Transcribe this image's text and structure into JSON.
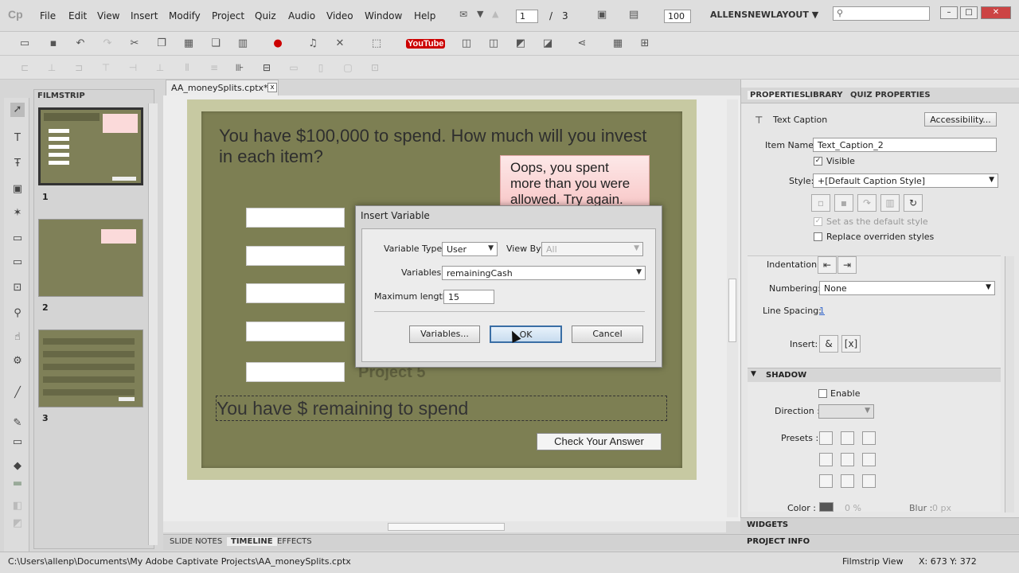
{
  "menubar": {
    "logo": "Cp",
    "items": [
      "File",
      "Edit",
      "View",
      "Insert",
      "Modify",
      "Project",
      "Quiz",
      "Audio",
      "Video",
      "Window",
      "Help"
    ],
    "page_current": "1",
    "page_separator": "/",
    "page_total": "3",
    "zoom": "100",
    "workspace": "ALLENSNEWLAYOUT"
  },
  "toolbar": {
    "youtube_label": "YouTube"
  },
  "filmstrip": {
    "title": "FILMSTRIP",
    "slides": [
      {
        "number": "1"
      },
      {
        "number": "2"
      },
      {
        "number": "3"
      }
    ]
  },
  "document": {
    "tab_label": "AA_moneySplits.cptx*",
    "close_label": "x"
  },
  "slide": {
    "headline": "You have $100,000 to spend.  How much will you invest in each item?",
    "feedback": "Oops, you spent more than you were allowed. Try again.",
    "project5": "Project 5",
    "remaining_text": "You have $   remaining to spend",
    "check_button": "Check Your Answer"
  },
  "bottom_tabs": [
    "SLIDE NOTES",
    "TIMELINE",
    "EFFECTS"
  ],
  "dialog": {
    "title": "Insert Variable",
    "variable_type_label": "Variable Type",
    "variable_type_value": "User",
    "view_by_label": "View By",
    "view_by_value": "All",
    "variables_label": "Variables",
    "variables_value": "remainingCash",
    "max_length_label": "Maximum length",
    "max_length_value": "15",
    "variables_button": "Variables...",
    "ok_button": "OK",
    "cancel_button": "Cancel"
  },
  "properties": {
    "tabs": [
      "PROPERTIES",
      "LIBRARY",
      "QUIZ PROPERTIES"
    ],
    "object_type": "Text Caption",
    "accessibility_button": "Accessibility...",
    "item_name_label": "Item Name:",
    "item_name_value": "Text_Caption_2",
    "visible_label": "Visible",
    "style_label": "Style:",
    "style_value": "+[Default Caption Style]",
    "default_style_label": "Set as the default style",
    "replace_label": "Replace overriden styles",
    "indentation_label": "Indentation:",
    "numbering_label": "Numbering:",
    "numbering_value": "None",
    "line_spacing_label": "Line Spacing:",
    "line_spacing_value": "1",
    "insert_label": "Insert:",
    "shadow_section": "SHADOW",
    "enable_label": "Enable",
    "direction_label": "Direction :",
    "presets_label": "Presets :",
    "color_label": "Color :",
    "color_pct": "0 %",
    "blur_label": "Blur :",
    "blur_value": "0 px"
  },
  "panels": {
    "widgets": "WIDGETS",
    "project_info": "PROJECT INFO"
  },
  "statusbar": {
    "path": "C:\\Users\\allenp\\Documents\\My Adobe Captivate Projects\\AA_moneySplits.cptx",
    "view": "Filmstrip View",
    "coords": "X: 673 Y: 372"
  },
  "colors": {
    "slide_background": "#7d7f53",
    "slide_border": "#c7c9a2",
    "feedback_fill": "#f8c8c8"
  }
}
